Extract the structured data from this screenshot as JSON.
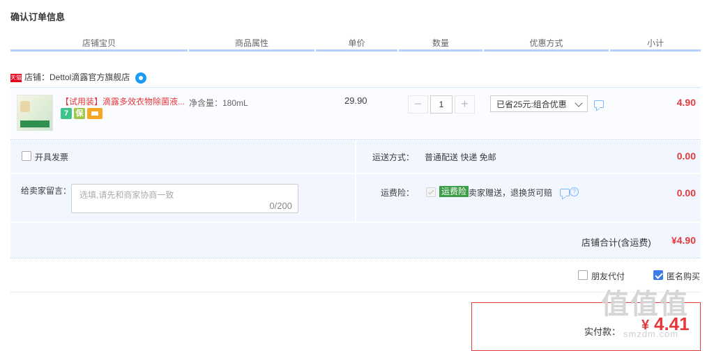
{
  "page": {
    "title": "确认订单信息"
  },
  "columns": [
    "店铺宝贝",
    "商品属性",
    "单价",
    "数量",
    "优惠方式",
    "小计"
  ],
  "shop": {
    "badge": "天猫",
    "label": "店铺：Dettol滴露官方旗舰店",
    "chat_icon": "wangwang-icon"
  },
  "item": {
    "name": "【试用装】滴露多效衣物除菌液...",
    "attr": "净含量：180mL",
    "price": "29.90",
    "quantity": "1",
    "minus": "−",
    "plus": "+",
    "promo_selected": "已省25元:组合优惠",
    "subtotal": "4.90",
    "service_icons": [
      "7",
      "保",
      "card-icon"
    ]
  },
  "invoice": {
    "label": "开具发票"
  },
  "shipping": {
    "label": "运送方式：",
    "value": "普通配送 快递 免邮",
    "amount": "0.00"
  },
  "message": {
    "label": "给卖家留言：",
    "placeholder": "选填,请先和商家协商一致",
    "counter": "0/200"
  },
  "insurance": {
    "label": "运费险：",
    "badge": "运费险",
    "desc": "卖家赠送，退换货可赔",
    "amount": "0.00"
  },
  "shop_total": {
    "label": "店铺合计(含运费)",
    "amount": "¥4.90"
  },
  "options": {
    "friend_pay": "朋友代付",
    "anonymous": "匿名购买",
    "anonymous_checked": true
  },
  "payment": {
    "label": "实付款：",
    "currency": "¥",
    "amount": "4.41"
  },
  "watermark": {
    "main": "值值值",
    "sub": "smzdm.com"
  },
  "colors": {
    "accent": "#e4393c",
    "header_line": "#b2d1ff",
    "panel_bg": "#f2f7ff",
    "checkbox_blue": "#3d7de9"
  }
}
